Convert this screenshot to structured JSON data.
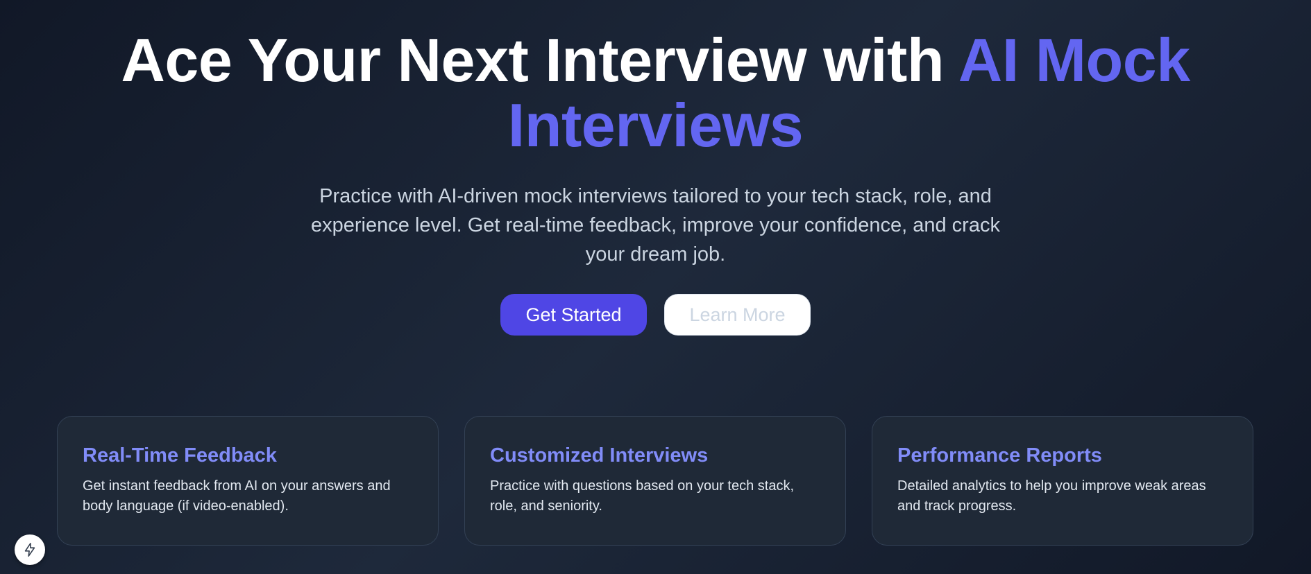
{
  "hero": {
    "headline_part1": "Ace Your Next Interview with ",
    "headline_accent": "AI Mock Interviews",
    "subtitle": "Practice with AI-driven mock interviews tailored to your tech stack, role, and experience level. Get real-time feedback, improve your confidence, and crack your dream job.",
    "primary_button": "Get Started",
    "secondary_button": "Learn More"
  },
  "features": [
    {
      "title": "Real-Time Feedback",
      "description": "Get instant feedback from AI on your answers and body language (if video-enabled)."
    },
    {
      "title": "Customized Interviews",
      "description": "Practice with questions based on your tech stack, role, and seniority."
    },
    {
      "title": "Performance Reports",
      "description": "Detailed analytics to help you improve weak areas and track progress."
    }
  ],
  "fab": {
    "icon": "lightning-icon"
  },
  "colors": {
    "accent": "#6366f1",
    "primary_button": "#4f46e5",
    "card_title": "#818cf8",
    "background": "#111827"
  }
}
